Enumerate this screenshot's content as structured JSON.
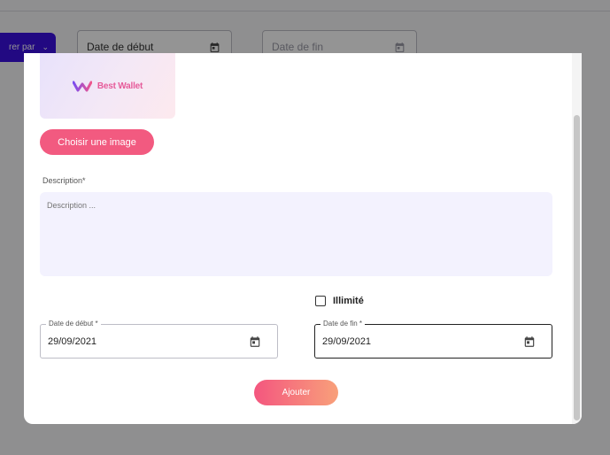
{
  "background": {
    "filter_button_label": "rer par",
    "start_date_placeholder": "Date de début",
    "end_date_placeholder": "Date de fin"
  },
  "modal": {
    "brand_name": "Best Wallet",
    "choose_image_label": "Choisir une image",
    "description_label": "Description*",
    "description_placeholder": "Description ...",
    "unlimited_label": "Illimité",
    "unlimited_checked": false,
    "start_date": {
      "label": "Date de début *",
      "value": "29/09/2021"
    },
    "end_date": {
      "label": "Date de fin *",
      "value": "29/09/2021"
    },
    "submit_label": "Ajouter"
  },
  "colors": {
    "primary": "#f25a80",
    "gradient_end": "#f8a07a",
    "filter_button": "#3b10e0",
    "description_bg": "#f3f2fe",
    "brand_text": "#e65b9a"
  },
  "icons": [
    "calendar-icon",
    "chevron-down-icon",
    "best-wallet-logo-icon"
  ]
}
